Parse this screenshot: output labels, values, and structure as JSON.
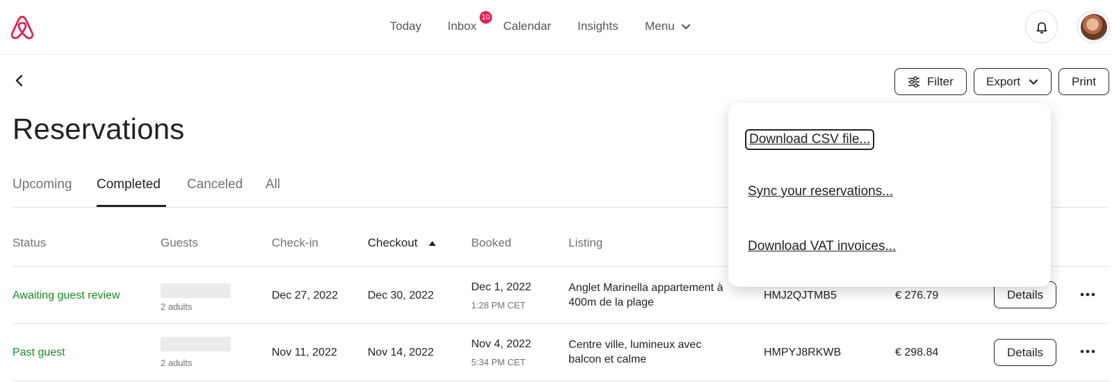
{
  "nav": {
    "today": "Today",
    "inbox": "Inbox",
    "inbox_badge": "10",
    "calendar": "Calendar",
    "insights": "Insights",
    "menu": "Menu"
  },
  "toolbar": {
    "filter": "Filter",
    "export": "Export",
    "print": "Print"
  },
  "page_title": "Reservations",
  "tabs": [
    {
      "label": "Upcoming"
    },
    {
      "label": "Completed"
    },
    {
      "label": "Canceled"
    },
    {
      "label": "All"
    }
  ],
  "active_tab": "Completed",
  "table": {
    "headers": {
      "status": "Status",
      "guests": "Guests",
      "checkin": "Check-in",
      "checkout": "Checkout",
      "booked": "Booked",
      "listing": "Listing"
    },
    "rows": [
      {
        "status": "Awaiting guest review",
        "guests": "2 adults",
        "checkin": "Dec 27, 2022",
        "checkout": "Dec 30, 2022",
        "booked_date": "Dec 1, 2022",
        "booked_time": "1:28 PM CET",
        "listing_line1": "Anglet Marinella appartement à",
        "listing_line2": "400m de la plage",
        "code": "HMJ2QJTMB5",
        "payout": "€ 276.79",
        "details": "Details"
      },
      {
        "status": "Past guest",
        "guests": "2 adults",
        "checkin": "Nov 11, 2022",
        "checkout": "Nov 14, 2022",
        "booked_date": "Nov 4, 2022",
        "booked_time": "5:34 PM CET",
        "listing_line1": "Centre ville, lumineux avec",
        "listing_line2": "balcon et calme",
        "code": "HMPYJ8RKWB",
        "payout": "€ 298.84",
        "details": "Details"
      }
    ]
  },
  "export_menu": {
    "items": [
      {
        "label": "Download CSV file..."
      },
      {
        "label": "Sync your reservations..."
      },
      {
        "label": "Download VAT invoices..."
      }
    ]
  },
  "colors": {
    "brand": "#e51d53",
    "status_green": "#178a1e"
  }
}
